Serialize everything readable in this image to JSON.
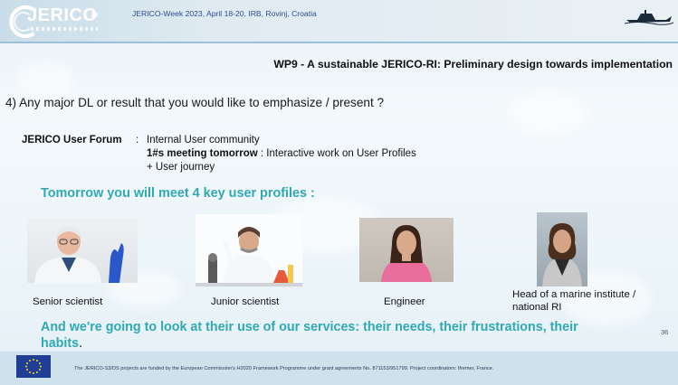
{
  "header": {
    "logo_text": "JERICO",
    "logo_suffix": "RI",
    "event_title": "JERICO-Week 2023, April 18-20, IRB, Rovinj, Croatia",
    "boat_icon": "research-vessel-icon"
  },
  "slide": {
    "title": "WP9 - A sustainable JERICO-RI: Preliminary design towards implementation",
    "question": "4) Any major DL or result that you would like to emphasize / present ?",
    "forum": {
      "label": "JERICO User Forum",
      "colon": ":",
      "text": "Internal User community",
      "meeting_bold": "1#s meeting tomorrow",
      "meeting_rest": " : Interactive work on User Profiles",
      "journey": "+ User journey"
    },
    "tomorrow_heading": "Tomorrow you will meet 4 key user profiles :",
    "profiles": [
      {
        "caption": "Senior scientist"
      },
      {
        "caption": "Junior scientist"
      },
      {
        "caption": "Engineer"
      },
      {
        "caption": "Head of a marine institute / national RI"
      }
    ],
    "bottom_text": "And we're going to look at their use of our services: their needs, their frustrations, their habits",
    "bottom_dot": ".",
    "page_number": "36"
  },
  "footer": {
    "text": "The JERICO-S3/DS projects are funded by the European Commission's H2020 Framework Programme under grant agreements No. 871153/951799. Project coordinators: Ifremer, France.",
    "flag_icon": "eu-flag-icon"
  },
  "colors": {
    "accent": "#30a9b2",
    "header_text": "#2d4e8c",
    "eu_blue": "#1f3f97"
  }
}
